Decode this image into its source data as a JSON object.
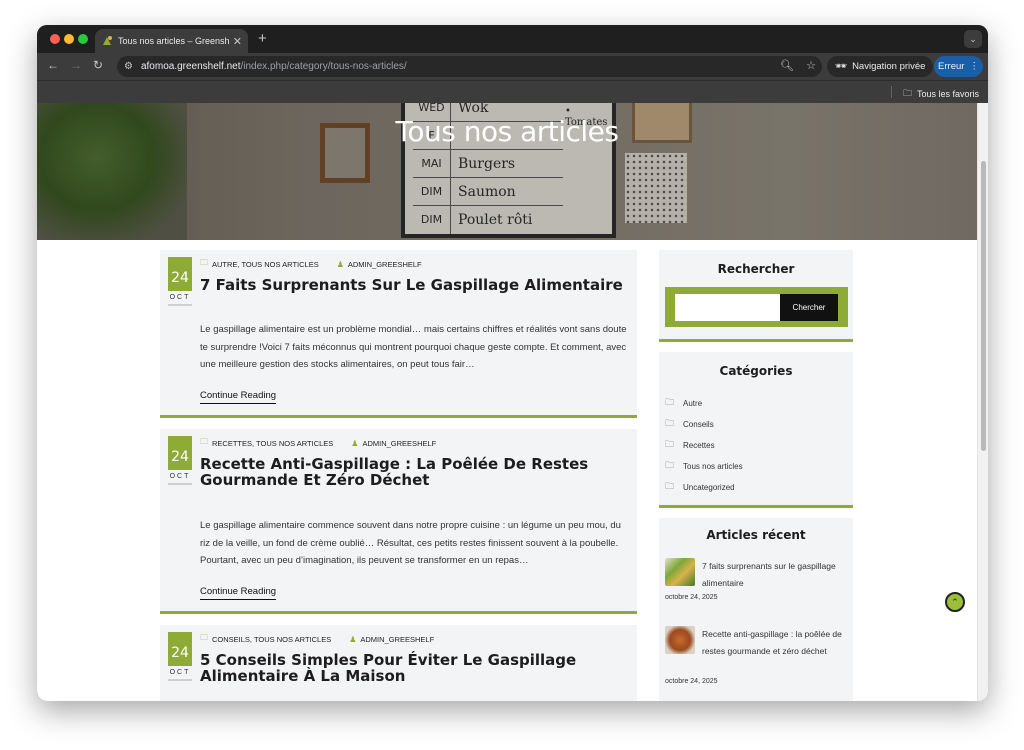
{
  "browser": {
    "tab_title": "Tous nos articles – Greenshelf",
    "new_tab": "+",
    "url_host": "afomoa.greenshelf.net",
    "url_path": "/index.php/category/tous-nos-articles/",
    "private_label": "Navigation privée",
    "error_label": "Erreur",
    "bookmarks_all": "Tous les favoris"
  },
  "hero": {
    "title": "Tous nos articles",
    "board": [
      {
        "day": "WED",
        "food": "Wok"
      },
      {
        "day": "F",
        "food": ""
      },
      {
        "day": "MAI",
        "food": "Burgers"
      },
      {
        "day": "DIM",
        "food": "Saumon"
      },
      {
        "day": "DIM",
        "food": "Poulet rôti"
      }
    ],
    "note": "• Tomates"
  },
  "posts": [
    {
      "day": "24",
      "month": "OCT",
      "categories": "AUTRE, TOUS NOS ARTICLES",
      "author": "ADMIN_GREESHELF",
      "title": "7 Faits Surprenants Sur Le Gaspillage Alimentaire",
      "excerpt": "Le gaspillage alimentaire est un problème mondial… mais certains chiffres et réalités vont sans doute te surprendre !Voici 7 faits méconnus qui montrent pourquoi chaque geste compte. Et comment, avec une meilleure gestion des stocks alimentaires, on peut tous fair…",
      "read_more": "Continue Reading"
    },
    {
      "day": "24",
      "month": "OCT",
      "categories": "RECETTES, TOUS NOS ARTICLES",
      "author": "ADMIN_GREESHELF",
      "title": "Recette Anti-Gaspillage : La Poêlée De Restes Gourmande Et Zéro Déchet",
      "excerpt": "Le gaspillage alimentaire commence souvent dans notre propre cuisine : un légume un peu mou, du riz de la veille, un fond de crème oublié… Résultat, ces petits restes finissent souvent à la poubelle. Pourtant, avec un peu d’imagination, ils peuvent se transformer en un repas…",
      "read_more": "Continue Reading"
    },
    {
      "day": "24",
      "month": "OCT",
      "categories": "CONSEILS, TOUS NOS ARTICLES",
      "author": "ADMIN_GREESHELF",
      "title": "5 Conseils Simples Pour Éviter Le Gaspillage Alimentaire À La Maison",
      "excerpt": "",
      "read_more": ""
    }
  ],
  "sidebar": {
    "search_title": "Rechercher",
    "search_button": "Chercher",
    "categories_title": "Catégories",
    "categories": [
      "Autre",
      "Conseils",
      "Recettes",
      "Tous nos articles",
      "Uncategorized"
    ],
    "recent_title": "Articles récent",
    "recent": [
      {
        "title": "7 faits surprenants sur le gaspillage alimentaire",
        "date": "octobre 24, 2025"
      },
      {
        "title": "Recette anti-gaspillage : la poêlée de restes gourmande et zéro déchet",
        "date": "octobre 24, 2025"
      }
    ]
  },
  "colors": {
    "accent": "#8fab37",
    "browser_dark": "#3c3c3c",
    "error_blue": "#1b5ea8"
  },
  "icons": {
    "back": "arrow-left-icon",
    "forward": "arrow-right-icon",
    "reload": "reload-icon",
    "scroll_top": "chevron-double-up-icon"
  }
}
